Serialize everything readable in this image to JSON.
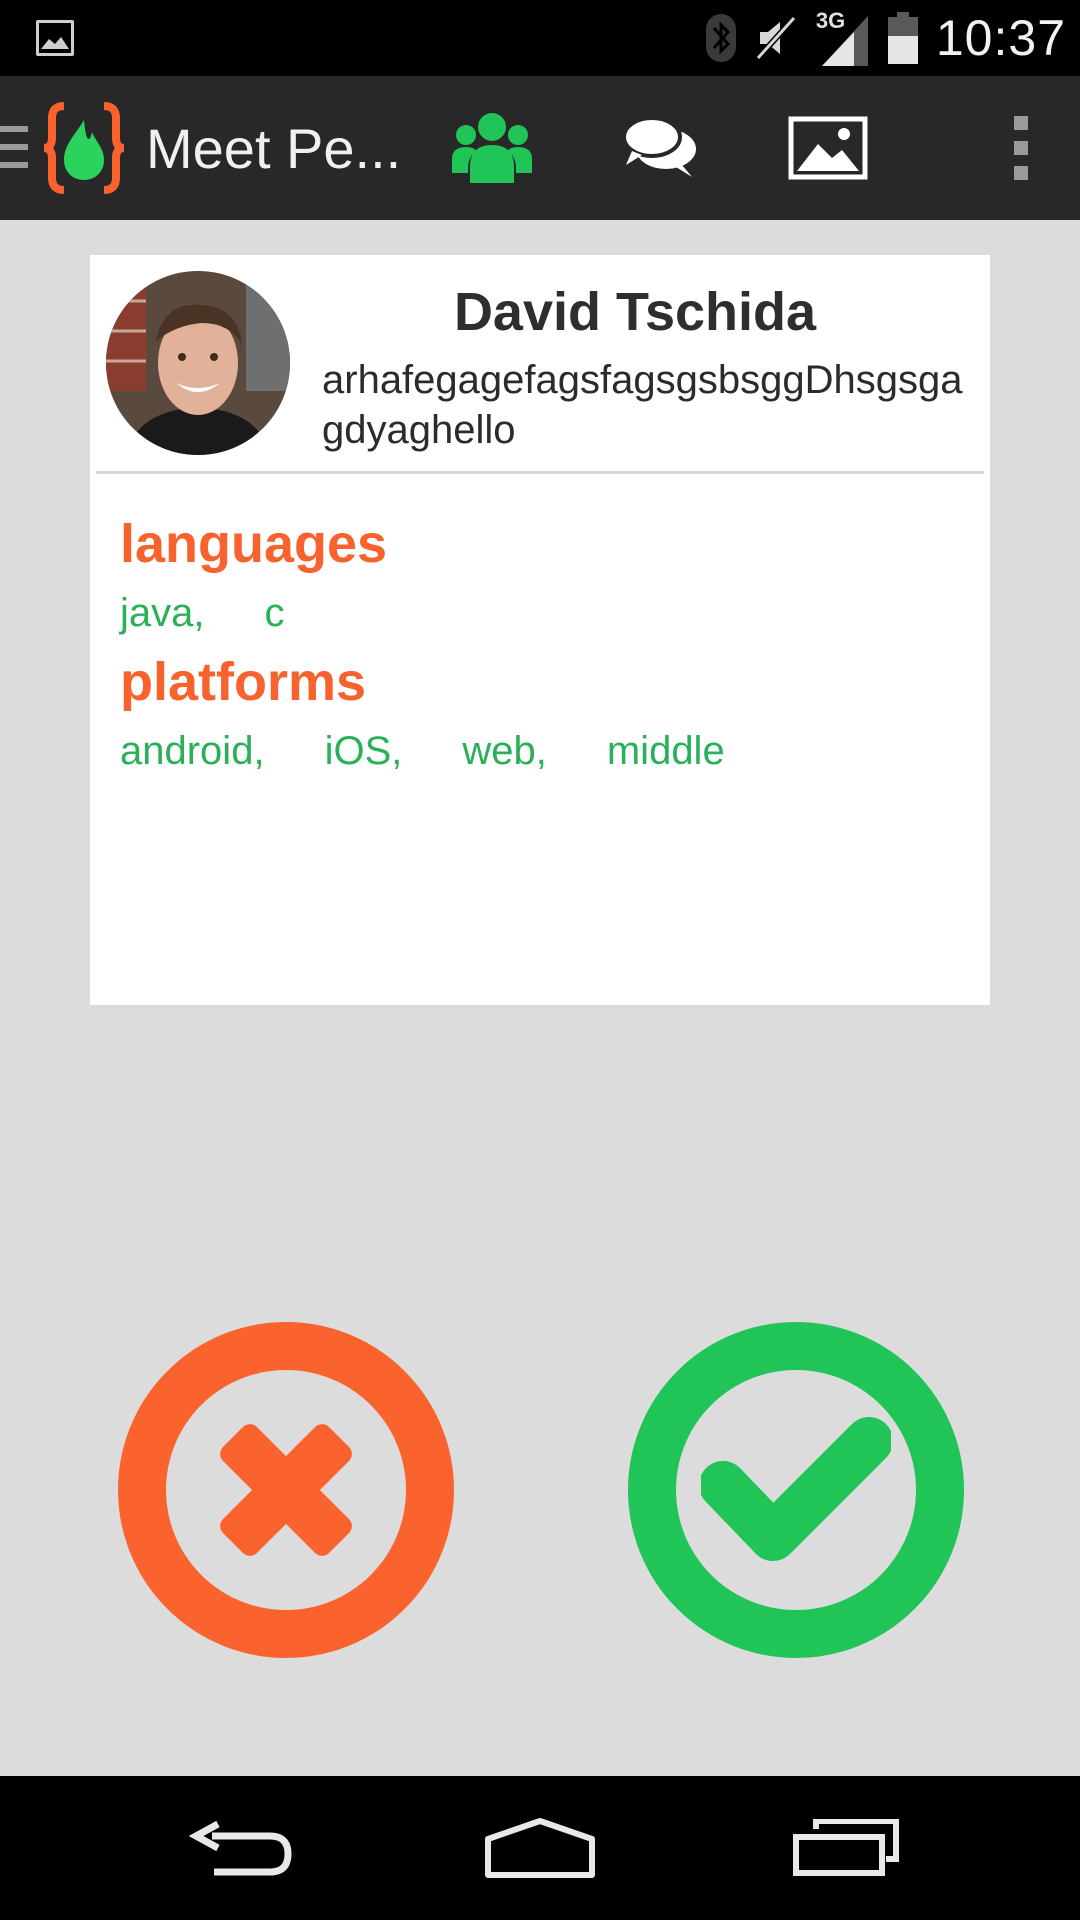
{
  "status_bar": {
    "time": "10:37",
    "network": "3G",
    "icons": [
      "gallery-notification-icon",
      "bluetooth-icon",
      "mute-icon",
      "signal-icon",
      "battery-icon"
    ]
  },
  "action_bar": {
    "title": "Meet Pe...",
    "actions": [
      "people-icon",
      "chat-icon",
      "image-icon",
      "overflow-menu-icon"
    ],
    "colors": {
      "active": "#21c457",
      "logo_orange": "#fb632e",
      "logo_green": "#2bd35c"
    }
  },
  "profile": {
    "name": "David Tschida",
    "bio": "arhafegagefagsfagsgsbsggDhsgsgagdyaghello",
    "sections": [
      {
        "title": "languages",
        "tags": [
          "java,",
          "c"
        ]
      },
      {
        "title": "platforms",
        "tags": [
          "android,",
          "iOS,",
          "web,",
          "middle"
        ]
      }
    ]
  },
  "buttons": {
    "reject": {
      "icon": "close-icon",
      "color": "#fb632e"
    },
    "accept": {
      "icon": "check-icon",
      "color": "#21c457"
    }
  },
  "nav_bar": [
    "back-icon",
    "home-icon",
    "recents-icon"
  ]
}
